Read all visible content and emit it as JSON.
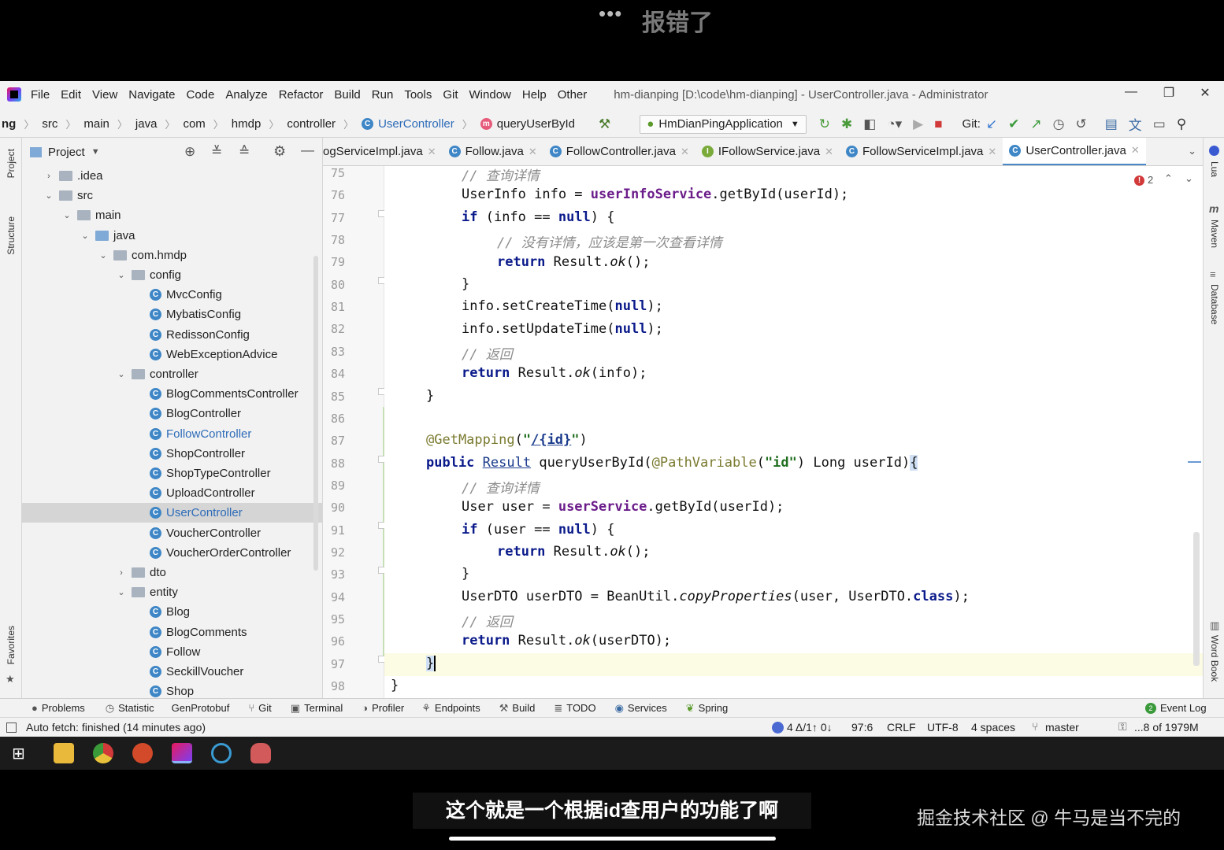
{
  "video": {
    "top_dots": "•••",
    "top_title": "报错了",
    "subtitle": "这个就是一个根据id查用户的功能了啊",
    "watermark": "掘金技术社区 @ 牛马是当不完的"
  },
  "menubar": {
    "items": [
      "File",
      "Edit",
      "View",
      "Navigate",
      "Code",
      "Analyze",
      "Refactor",
      "Build",
      "Run",
      "Tools",
      "Git",
      "Window",
      "Help",
      "Other"
    ],
    "title": "hm-dianping [D:\\code\\hm-dianping] - UserController.java - Administrator"
  },
  "navbar": {
    "crumbs": [
      "ng",
      "src",
      "main",
      "java",
      "com",
      "hmdp",
      "controller",
      "UserController",
      "queryUserById"
    ],
    "run_config": "HmDianPingApplication",
    "git_label": "Git:"
  },
  "project": {
    "header": "Project",
    "tree": [
      {
        "label": ".idea",
        "type": "folder"
      },
      {
        "label": "src",
        "type": "folder"
      },
      {
        "label": "main",
        "type": "folder"
      },
      {
        "label": "java",
        "type": "folder"
      },
      {
        "label": "com.hmdp",
        "type": "package"
      },
      {
        "label": "config",
        "type": "package"
      },
      {
        "label": "MvcConfig",
        "type": "class"
      },
      {
        "label": "MybatisConfig",
        "type": "class"
      },
      {
        "label": "RedissonConfig",
        "type": "class"
      },
      {
        "label": "WebExceptionAdvice",
        "type": "class"
      },
      {
        "label": "controller",
        "type": "package"
      },
      {
        "label": "BlogCommentsController",
        "type": "class"
      },
      {
        "label": "BlogController",
        "type": "class"
      },
      {
        "label": "FollowController",
        "type": "class"
      },
      {
        "label": "ShopController",
        "type": "class"
      },
      {
        "label": "ShopTypeController",
        "type": "class"
      },
      {
        "label": "UploadController",
        "type": "class"
      },
      {
        "label": "UserController",
        "type": "class"
      },
      {
        "label": "VoucherController",
        "type": "class"
      },
      {
        "label": "VoucherOrderController",
        "type": "class"
      },
      {
        "label": "dto",
        "type": "package"
      },
      {
        "label": "entity",
        "type": "package"
      },
      {
        "label": "Blog",
        "type": "class"
      },
      {
        "label": "BlogComments",
        "type": "class"
      },
      {
        "label": "Follow",
        "type": "class"
      },
      {
        "label": "SeckillVoucher",
        "type": "class"
      },
      {
        "label": "Shop",
        "type": "class"
      }
    ]
  },
  "tabs": [
    "ogServiceImpl.java",
    "Follow.java",
    "FollowController.java",
    "IFollowService.java",
    "FollowServiceImpl.java",
    "UserController.java"
  ],
  "editor": {
    "line_numbers": [
      "75",
      "76",
      "77",
      "78",
      "79",
      "80",
      "81",
      "82",
      "83",
      "84",
      "85",
      "86",
      "87",
      "88",
      "89",
      "90",
      "91",
      "92",
      "93",
      "94",
      "95",
      "96",
      "97",
      "98"
    ],
    "problem_count": "2"
  },
  "side_labels": {
    "left": [
      "Project",
      "Structure",
      "Favorites"
    ],
    "right": [
      "Lua",
      "Maven",
      "Database",
      "Word Book"
    ]
  },
  "tools": [
    "Problems",
    "Statistic",
    "GenProtobuf",
    "Git",
    "Terminal",
    "Profiler",
    "Endpoints",
    "Build",
    "TODO",
    "Services",
    "Spring"
  ],
  "event_log": "Event Log",
  "event_count": "2",
  "status": {
    "message": "Auto fetch: finished (14 minutes ago)",
    "git_changes": "4 Δ/1↑ 0↓",
    "position": "97:6",
    "line_sep": "CRLF",
    "encoding": "UTF-8",
    "indent": "4 spaces",
    "branch": "master",
    "memory": "...8 of 1979M"
  }
}
